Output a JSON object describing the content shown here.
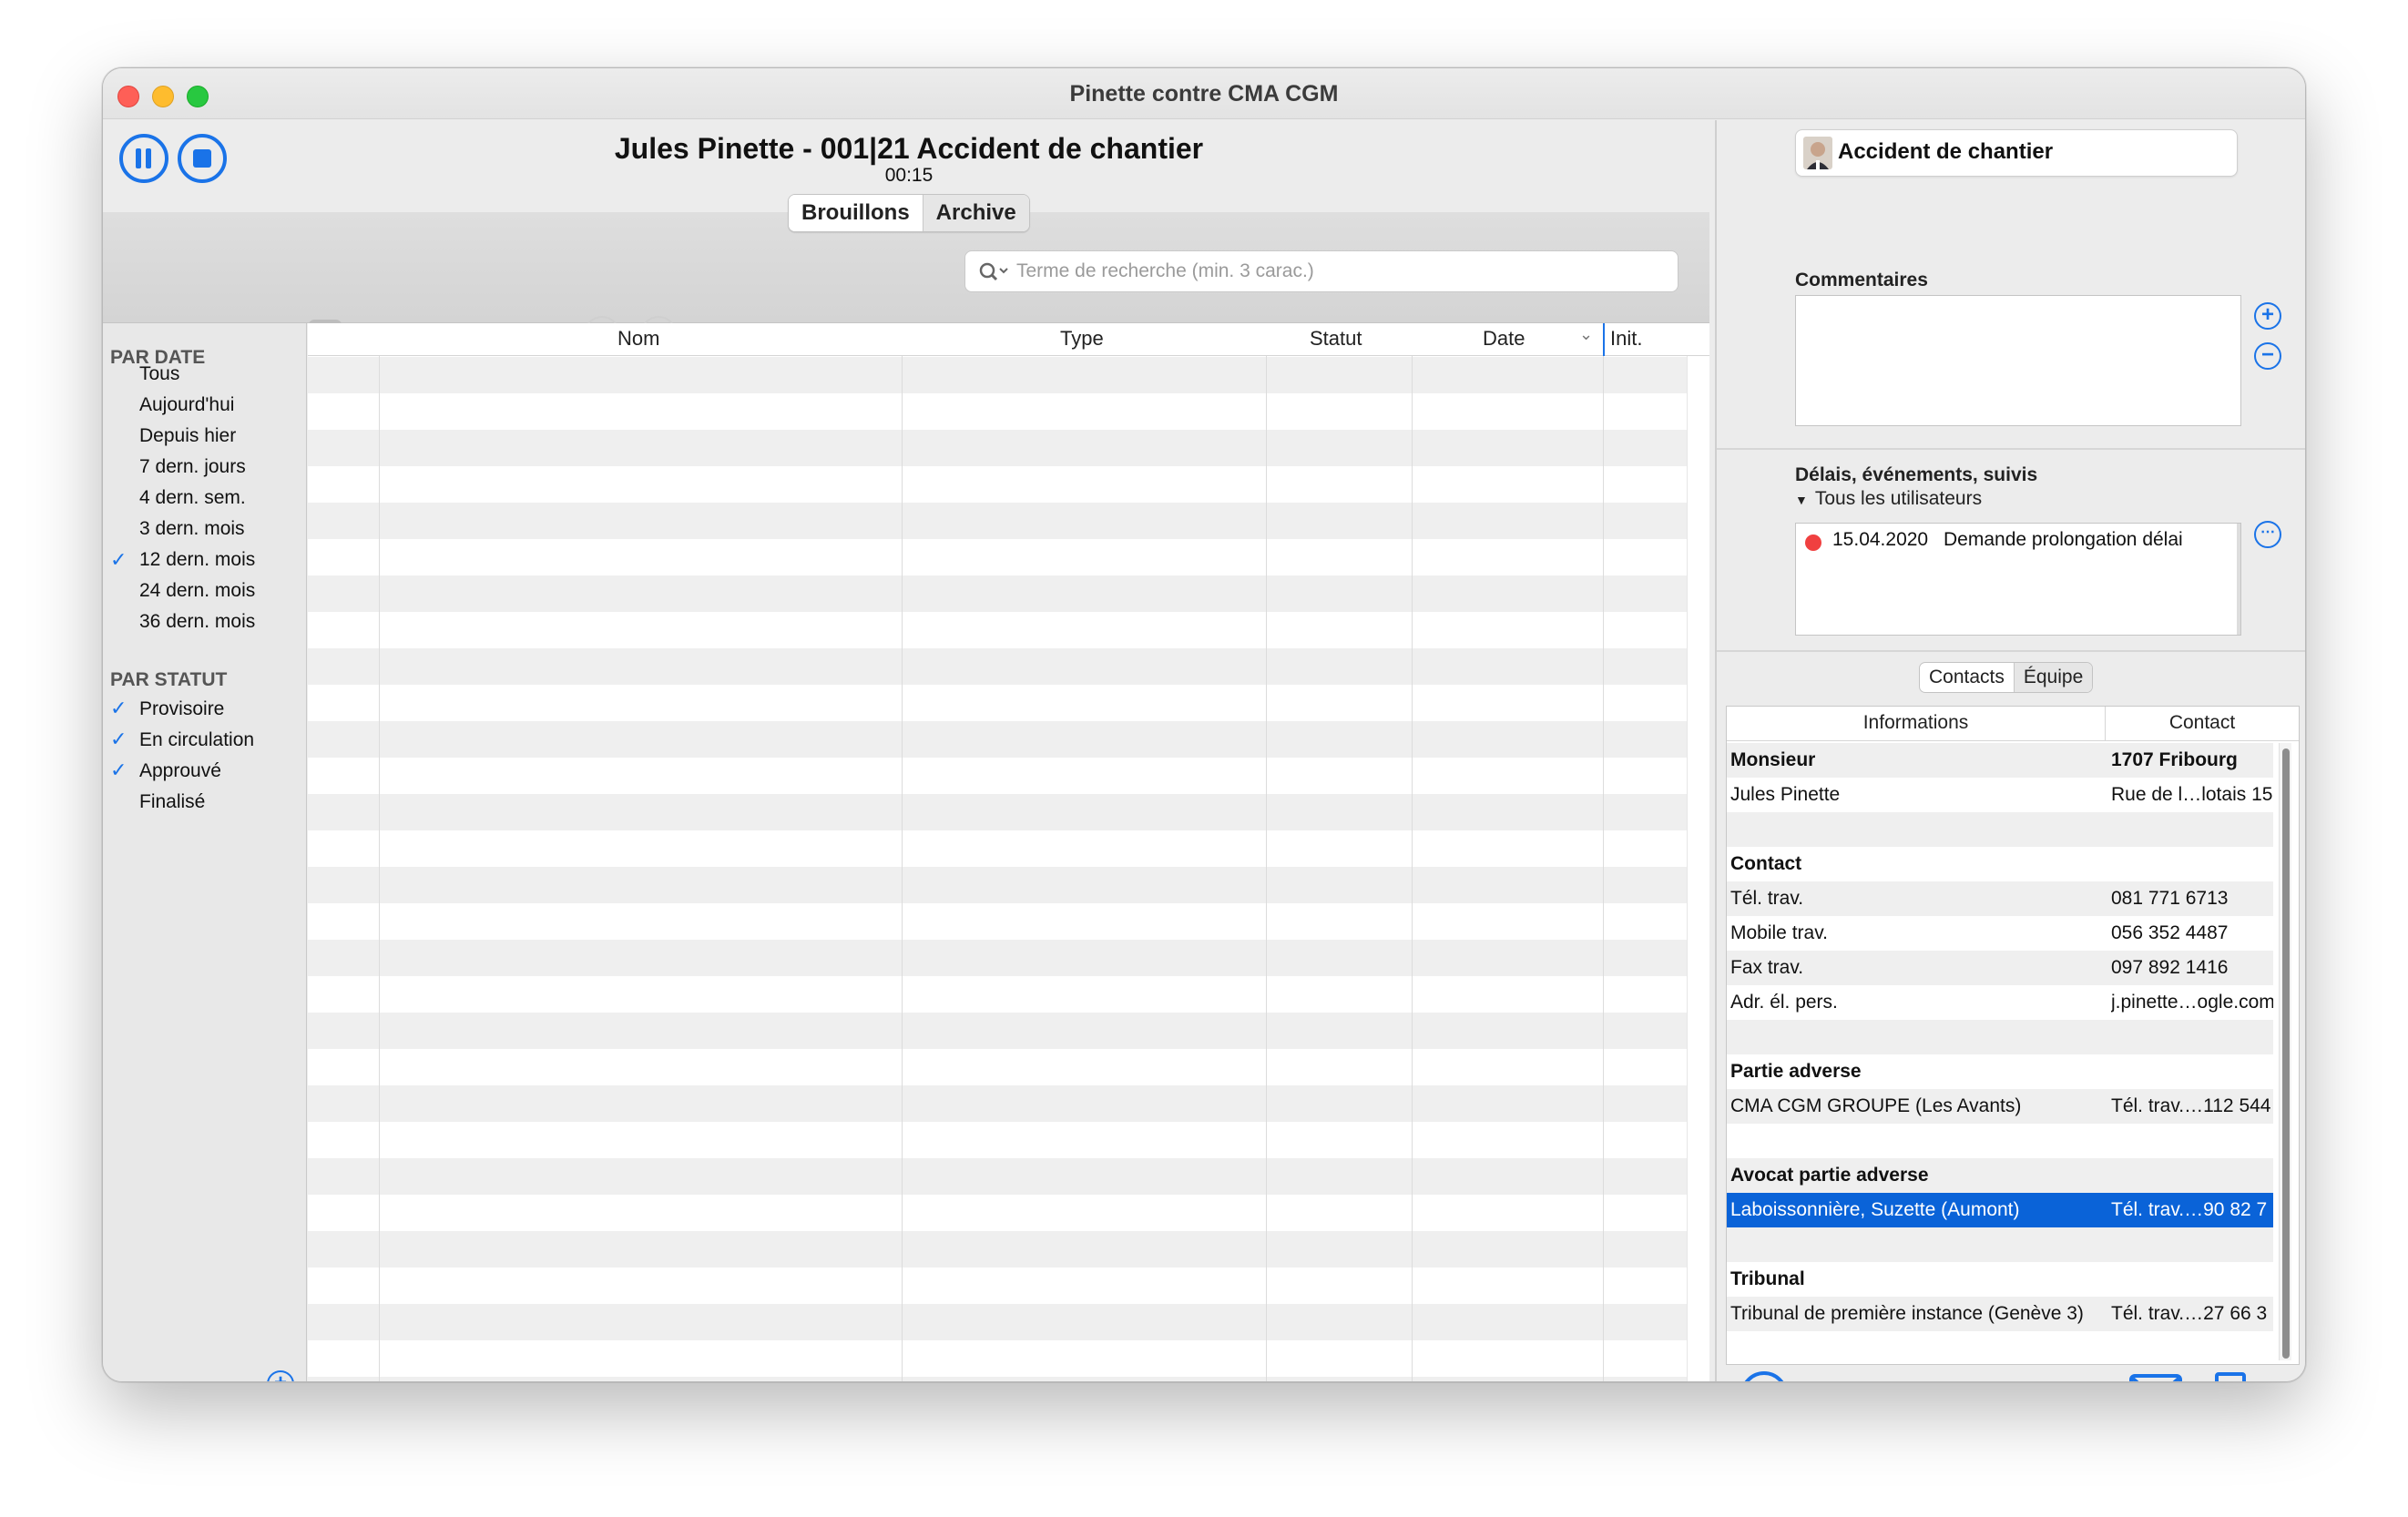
{
  "window": {
    "title": "Pinette contre CMA CGM"
  },
  "header": {
    "title": "Jules Pinette - 001|21 Accident de chantier",
    "timer": "00:15",
    "tabs": [
      "Brouillons",
      "Archive"
    ]
  },
  "search": {
    "placeholder": "Terme de recherche (min. 3 carac.)"
  },
  "sidebar": {
    "date_heading": "PAR DATE",
    "date_items": [
      "Tous",
      "Aujourd'hui",
      "Depuis hier",
      "7 dern. jours",
      "4 dern. sem.",
      "3 dern. mois",
      "12 dern. mois",
      "24 dern. mois",
      "36 dern. mois"
    ],
    "status_heading": "PAR STATUT",
    "status_items": [
      "Provisoire",
      "En circulation",
      "Approuvé",
      "Finalisé"
    ]
  },
  "table": {
    "columns": [
      "Nom",
      "Type",
      "Statut",
      "Date",
      "Init."
    ]
  },
  "right": {
    "case_title": "Accident de chantier",
    "comments_label": "Commentaires",
    "deadlines_label": "Délais, événements, suivis",
    "users_filter": "Tous les utilisateurs",
    "event": {
      "date": "15.04.2020",
      "text": "Demande prolongation délai",
      "color": "#f04040"
    },
    "tabs": [
      "Contacts",
      "Équipe"
    ],
    "contacts_columns": [
      "Informations",
      "Contact"
    ],
    "contacts": [
      {
        "a": "Monsieur",
        "b": "1707 Fribourg",
        "style": "bold"
      },
      {
        "a": "Jules Pinette",
        "b": "Rue de l…lotais 15",
        "style": ""
      },
      {
        "a": "",
        "b": "",
        "style": ""
      },
      {
        "a": "Contact",
        "b": "",
        "style": "bold"
      },
      {
        "a": "Tél. trav.",
        "b": "081 771 6713",
        "style": ""
      },
      {
        "a": "Mobile trav.",
        "b": "056 352 4487",
        "style": ""
      },
      {
        "a": "Fax trav.",
        "b": "097 892 1416",
        "style": ""
      },
      {
        "a": "Adr. él. pers.",
        "b": "j.pinette…ogle.com",
        "style": ""
      },
      {
        "a": "",
        "b": "",
        "style": ""
      },
      {
        "a": "Partie adverse",
        "b": "",
        "style": "bold"
      },
      {
        "a": "CMA CGM GROUPE (Les Avants)",
        "b": "Tél. trav.…112 544",
        "style": ""
      },
      {
        "a": "",
        "b": "",
        "style": ""
      },
      {
        "a": "Avocat partie adverse",
        "b": "",
        "style": "bold"
      },
      {
        "a": "Laboissonnière, Suzette (Aumont)",
        "b": "Tél. trav.…90 82 7",
        "style": "sel"
      },
      {
        "a": "",
        "b": "",
        "style": ""
      },
      {
        "a": "Tribunal",
        "b": "",
        "style": "bold"
      },
      {
        "a": "Tribunal de première instance (Genève 3)",
        "b": "Tél. trav.…27 66 3",
        "style": ""
      }
    ]
  },
  "colors": {
    "accent": "#1a73e8",
    "selection": "#0a63d8"
  }
}
